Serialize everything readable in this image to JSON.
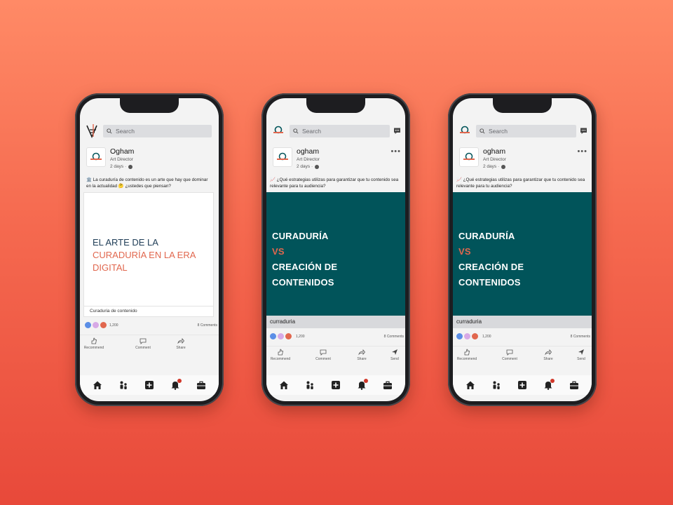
{
  "phones": [
    {
      "search_placeholder": "Search",
      "author": "Ogham",
      "role": "Art Director",
      "time": "2 days ·",
      "text": "La curaduría de contenido es un arte que hay que dominar en la actualidad 🤔 ¿ustedes que piensan?",
      "text_emoji": "🏛️",
      "media_lines": [
        "EL ARTE DE LA",
        "CURADURÍA EN LA ERA",
        "DIGITAL"
      ],
      "caption": "Curaduria de  contenido",
      "reactions": "1,200",
      "comments": "8 Comments",
      "actions": [
        "Recommend",
        "Comment",
        "Share"
      ]
    },
    {
      "search_placeholder": "Search",
      "author": "ogham",
      "role": "Art Director",
      "time": "2 days ·",
      "text": "¿Qué estrategias utilizas para garantizar que tu contenido sea relevante para tu audiencia?",
      "text_emoji": "📈",
      "media_lines": [
        "CURADURÍA",
        "VS",
        "CREACIÓN DE",
        "CONTENIDOS"
      ],
      "caption": "curraduria",
      "reactions": "1,200",
      "comments": "8 Comments",
      "actions": [
        "Recommend",
        "Comment",
        "Share",
        "Send"
      ]
    },
    {
      "search_placeholder": "Search",
      "author": "ogham",
      "role": "Art Director",
      "time": "2 days ·",
      "text": "¿Qué estrategias utilizas para garantizar que tu contenido sea relevante para tu audiencia?",
      "text_emoji": "📈",
      "media_lines": [
        "CURADURÍA",
        "VS",
        "CREACIÓN DE",
        "CONTENIDOS"
      ],
      "caption": "curraduria",
      "reactions": "1,200",
      "comments": "8 Comments",
      "actions": [
        "Recommend",
        "Comment",
        "Share",
        "Send"
      ]
    }
  ],
  "icons": {
    "nav": [
      "home-icon",
      "network-icon",
      "post-icon",
      "notifications-icon",
      "jobs-icon"
    ]
  },
  "colors": {
    "teal": "#01545a",
    "accent": "#e1674e",
    "navy": "#1f3d57",
    "badge": "#d1382a"
  }
}
